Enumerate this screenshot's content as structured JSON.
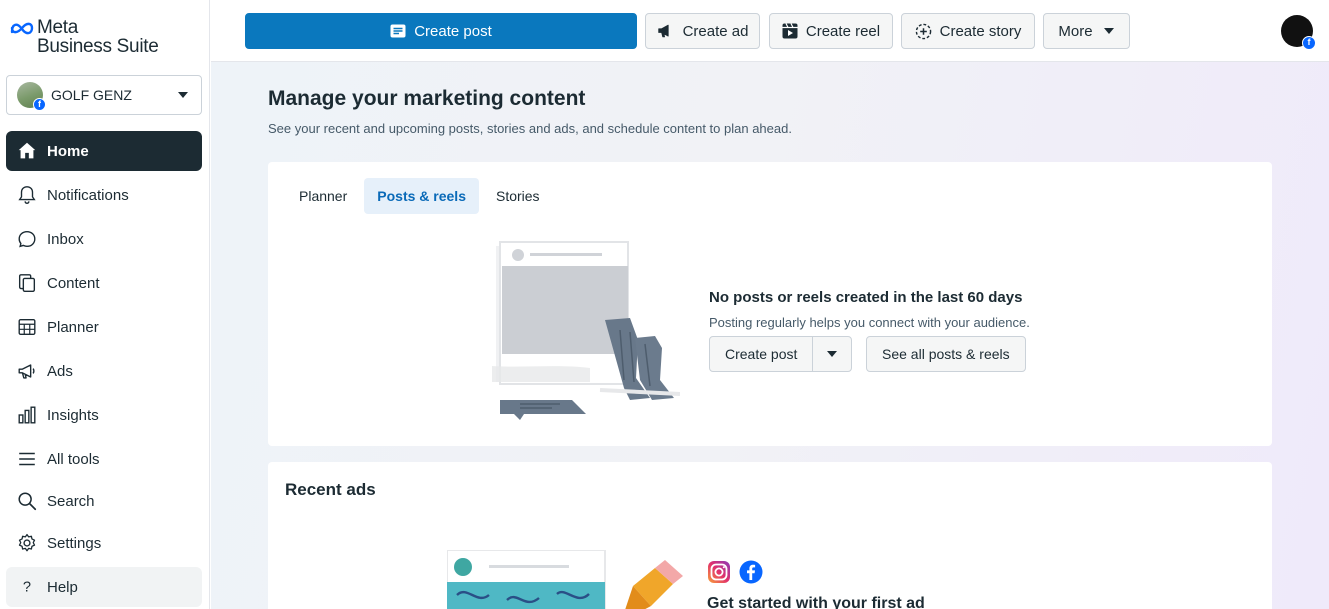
{
  "app": {
    "logo_line1": "Meta",
    "logo_line2": "Business Suite"
  },
  "account": {
    "name": "GOLF GENZ"
  },
  "sidebar": {
    "items": [
      {
        "label": "Home",
        "icon": "home-icon",
        "active": true
      },
      {
        "label": "Notifications",
        "icon": "bell-icon"
      },
      {
        "label": "Inbox",
        "icon": "chat-bubble-icon"
      },
      {
        "label": "Content",
        "icon": "content-icon"
      },
      {
        "label": "Planner",
        "icon": "calendar-grid-icon"
      },
      {
        "label": "Ads",
        "icon": "megaphone-icon"
      },
      {
        "label": "Insights",
        "icon": "bar-chart-icon"
      },
      {
        "label": "All tools",
        "icon": "menu-icon"
      },
      {
        "label": "Search",
        "icon": "search-icon"
      },
      {
        "label": "Settings",
        "icon": "gear-icon"
      },
      {
        "label": "Help",
        "icon": "question-icon"
      }
    ]
  },
  "toolbar": {
    "create_post": "Create post",
    "create_ad": "Create ad",
    "create_reel": "Create reel",
    "create_story": "Create story",
    "more": "More"
  },
  "main": {
    "title": "Manage your marketing content",
    "subtitle": "See your recent and upcoming posts, stories and ads, and schedule content to plan ahead.",
    "tabs": [
      {
        "label": "Planner",
        "active": false
      },
      {
        "label": "Posts & reels",
        "active": true
      },
      {
        "label": "Stories",
        "active": false
      }
    ],
    "empty": {
      "title": "No posts or reels created in the last 60 days",
      "subtitle": "Posting regularly helps you connect with your audience.",
      "create_post": "Create post",
      "see_all": "See all posts & reels"
    },
    "recent_ads": {
      "title": "Recent ads",
      "headline": "Get started with your first ad"
    }
  },
  "colors": {
    "primary": "#0a78be",
    "sidebar_active": "#1c2b33",
    "tab_active_bg": "#e6f0fa",
    "facebook_blue": "#0866ff"
  }
}
